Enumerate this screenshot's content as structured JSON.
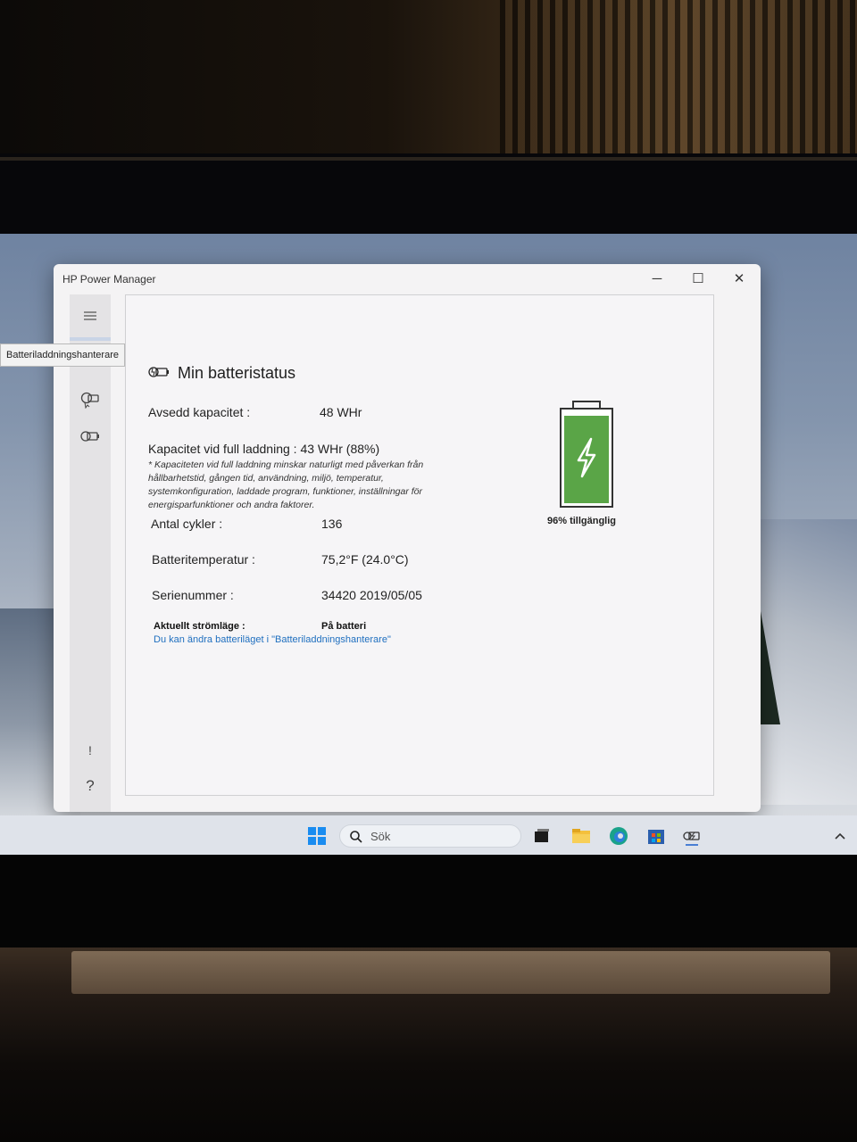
{
  "window": {
    "title": "HP Power Manager",
    "minimize_glyph": "─",
    "maximize_glyph": "☐",
    "close_glyph": "✕"
  },
  "tooltip": "Batteriladdningshanterare",
  "sidebar": {
    "items": [
      {
        "icon": "hamburger-menu-icon"
      },
      {
        "icon": "battery-manager-icon"
      },
      {
        "icon": "battery-status-icon"
      },
      {
        "icon": "alert-icon",
        "glyph": "!"
      },
      {
        "icon": "help-icon",
        "glyph": "?"
      }
    ]
  },
  "status": {
    "heading": "Min batteristatus",
    "rated_capacity_label": "Avsedd kapacitet :",
    "rated_capacity_value": "48 WHr",
    "full_charge_label": "Kapacitet vid full laddning : 43 WHr (88%)",
    "full_charge_note": "* Kapaciteten vid full laddning minskar naturligt med påverkan från hållbarhetstid, gången tid, användning, miljö, temperatur, systemkonfiguration, laddade program, funktioner, inställningar för energisparfunktioner och andra faktorer.",
    "cycles_label": "Antal cykler :",
    "cycles_value": "136",
    "temp_label": "Batteritemperatur :",
    "temp_value": "75,2°F (24.0°C)",
    "serial_label": "Serienummer :",
    "serial_value": "34420 2019/05/05",
    "power_mode_label": "Aktuellt strömläge :",
    "power_mode_value": "På batteri",
    "change_mode_link": "Du kan ändra batteriläget i \"Batteriladdningshanterare\""
  },
  "battery": {
    "available_text": "96% tillgänglig",
    "level": 0.96,
    "fill_color": "#5aa547"
  },
  "taskbar": {
    "search_placeholder": "Sök",
    "icons": [
      "start-icon",
      "search-icon",
      "task-view-icon",
      "file-explorer-icon",
      "edge-icon",
      "store-icon",
      "hp-power-manager-icon",
      "chevron-up-icon"
    ]
  }
}
